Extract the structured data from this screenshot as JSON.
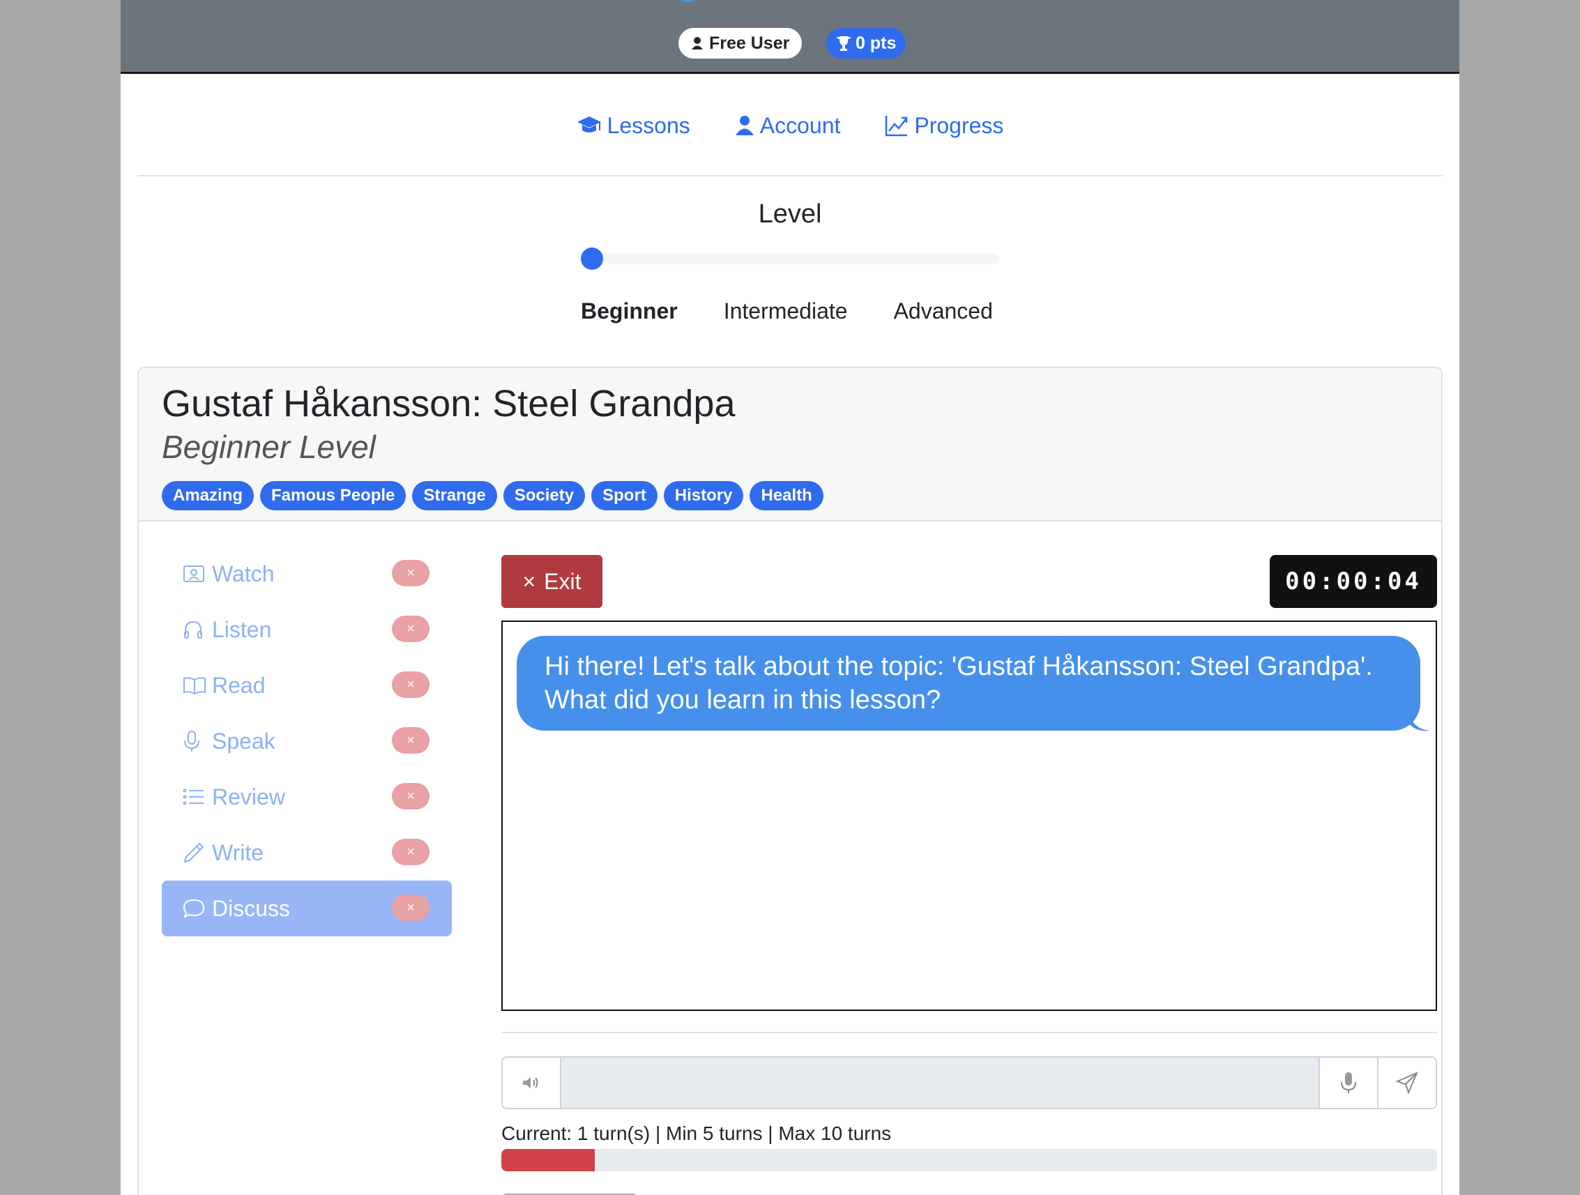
{
  "header": {
    "user_badge": "Free User",
    "points_badge": "0 pts"
  },
  "nav": {
    "items": [
      {
        "label": "Lessons",
        "icon": "graduation-cap-icon"
      },
      {
        "label": "Account",
        "icon": "user-icon"
      },
      {
        "label": "Progress",
        "icon": "chart-line-icon"
      }
    ]
  },
  "level": {
    "title": "Level",
    "options": [
      "Beginner",
      "Intermediate",
      "Advanced"
    ],
    "selected": "Beginner",
    "slider_value": 0
  },
  "lesson": {
    "title": "Gustaf Håkansson: Steel Grandpa",
    "subtitle": "Beginner Level",
    "tags": [
      "Amazing",
      "Famous People",
      "Strange",
      "Society",
      "Sport",
      "History",
      "Health"
    ]
  },
  "sidebar": {
    "items": [
      {
        "label": "Watch",
        "icon": "video-icon"
      },
      {
        "label": "Listen",
        "icon": "headphones-icon"
      },
      {
        "label": "Read",
        "icon": "book-icon"
      },
      {
        "label": "Speak",
        "icon": "microphone-icon"
      },
      {
        "label": "Review",
        "icon": "list-icon"
      },
      {
        "label": "Write",
        "icon": "pencil-icon"
      },
      {
        "label": "Discuss",
        "icon": "chat-icon"
      }
    ],
    "active": "Discuss",
    "status_glyph": "×"
  },
  "discuss": {
    "exit_label": "Exit",
    "exit_glyph": "×",
    "timer": "00:00:04",
    "messages": [
      {
        "role": "bot",
        "text": "Hi there! Let's talk about the topic: 'Gustaf Håkansson: Steel Grandpa'. What did you learn in this lesson?"
      }
    ],
    "input_value": "",
    "turns_text": "Current: 1 turn(s) | Min 5 turns | Max 10 turns",
    "turn_progress": 0.1,
    "colors": {
      "bubble": "#4690eb",
      "exit": "#b03a3f",
      "progress": "#d04348",
      "accent": "#2f6bed"
    }
  }
}
